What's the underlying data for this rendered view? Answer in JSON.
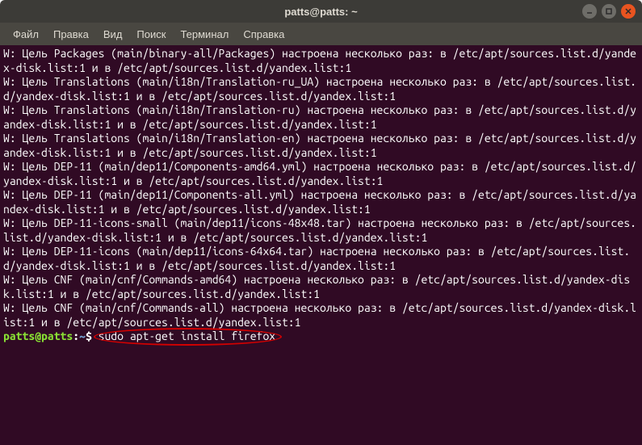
{
  "window": {
    "title": "patts@patts: ~"
  },
  "menu": {
    "file": "Файл",
    "edit": "Правка",
    "view": "Вид",
    "search": "Поиск",
    "terminal": "Терминал",
    "help": "Справка"
  },
  "terminal": {
    "lines": [
      "W: Цель Packages (main/binary-all/Packages) настроена несколько раз: в /etc/apt/sources.list.d/yandex-disk.list:1 и в /etc/apt/sources.list.d/yandex.list:1",
      "W: Цель Translations (main/i18n/Translation-ru_UA) настроена несколько раз: в /etc/apt/sources.list.d/yandex-disk.list:1 и в /etc/apt/sources.list.d/yandex.list:1",
      "W: Цель Translations (main/i18n/Translation-ru) настроена несколько раз: в /etc/apt/sources.list.d/yandex-disk.list:1 и в /etc/apt/sources.list.d/yandex.list:1",
      "W: Цель Translations (main/i18n/Translation-en) настроена несколько раз: в /etc/apt/sources.list.d/yandex-disk.list:1 и в /etc/apt/sources.list.d/yandex.list:1",
      "W: Цель DEP-11 (main/dep11/Components-amd64.yml) настроена несколько раз: в /etc/apt/sources.list.d/yandex-disk.list:1 и в /etc/apt/sources.list.d/yandex.list:1",
      "W: Цель DEP-11 (main/dep11/Components-all.yml) настроена несколько раз: в /etc/apt/sources.list.d/yandex-disk.list:1 и в /etc/apt/sources.list.d/yandex.list:1",
      "W: Цель DEP-11-icons-small (main/dep11/icons-48x48.tar) настроена несколько раз: в /etc/apt/sources.list.d/yandex-disk.list:1 и в /etc/apt/sources.list.d/yandex.list:1",
      "W: Цель DEP-11-icons (main/dep11/icons-64x64.tar) настроена несколько раз: в /etc/apt/sources.list.d/yandex-disk.list:1 и в /etc/apt/sources.list.d/yandex.list:1",
      "W: Цель CNF (main/cnf/Commands-amd64) настроена несколько раз: в /etc/apt/sources.list.d/yandex-disk.list:1 и в /etc/apt/sources.list.d/yandex.list:1",
      "W: Цель CNF (main/cnf/Commands-all) настроена несколько раз: в /etc/apt/sources.list.d/yandex-disk.list:1 и в /etc/apt/sources.list.d/yandex.list:1"
    ],
    "prompt": {
      "user_host": "patts@patts",
      "colon": ":",
      "path": "~",
      "dollar": "$"
    },
    "command": "sudo apt-get install firefox"
  }
}
